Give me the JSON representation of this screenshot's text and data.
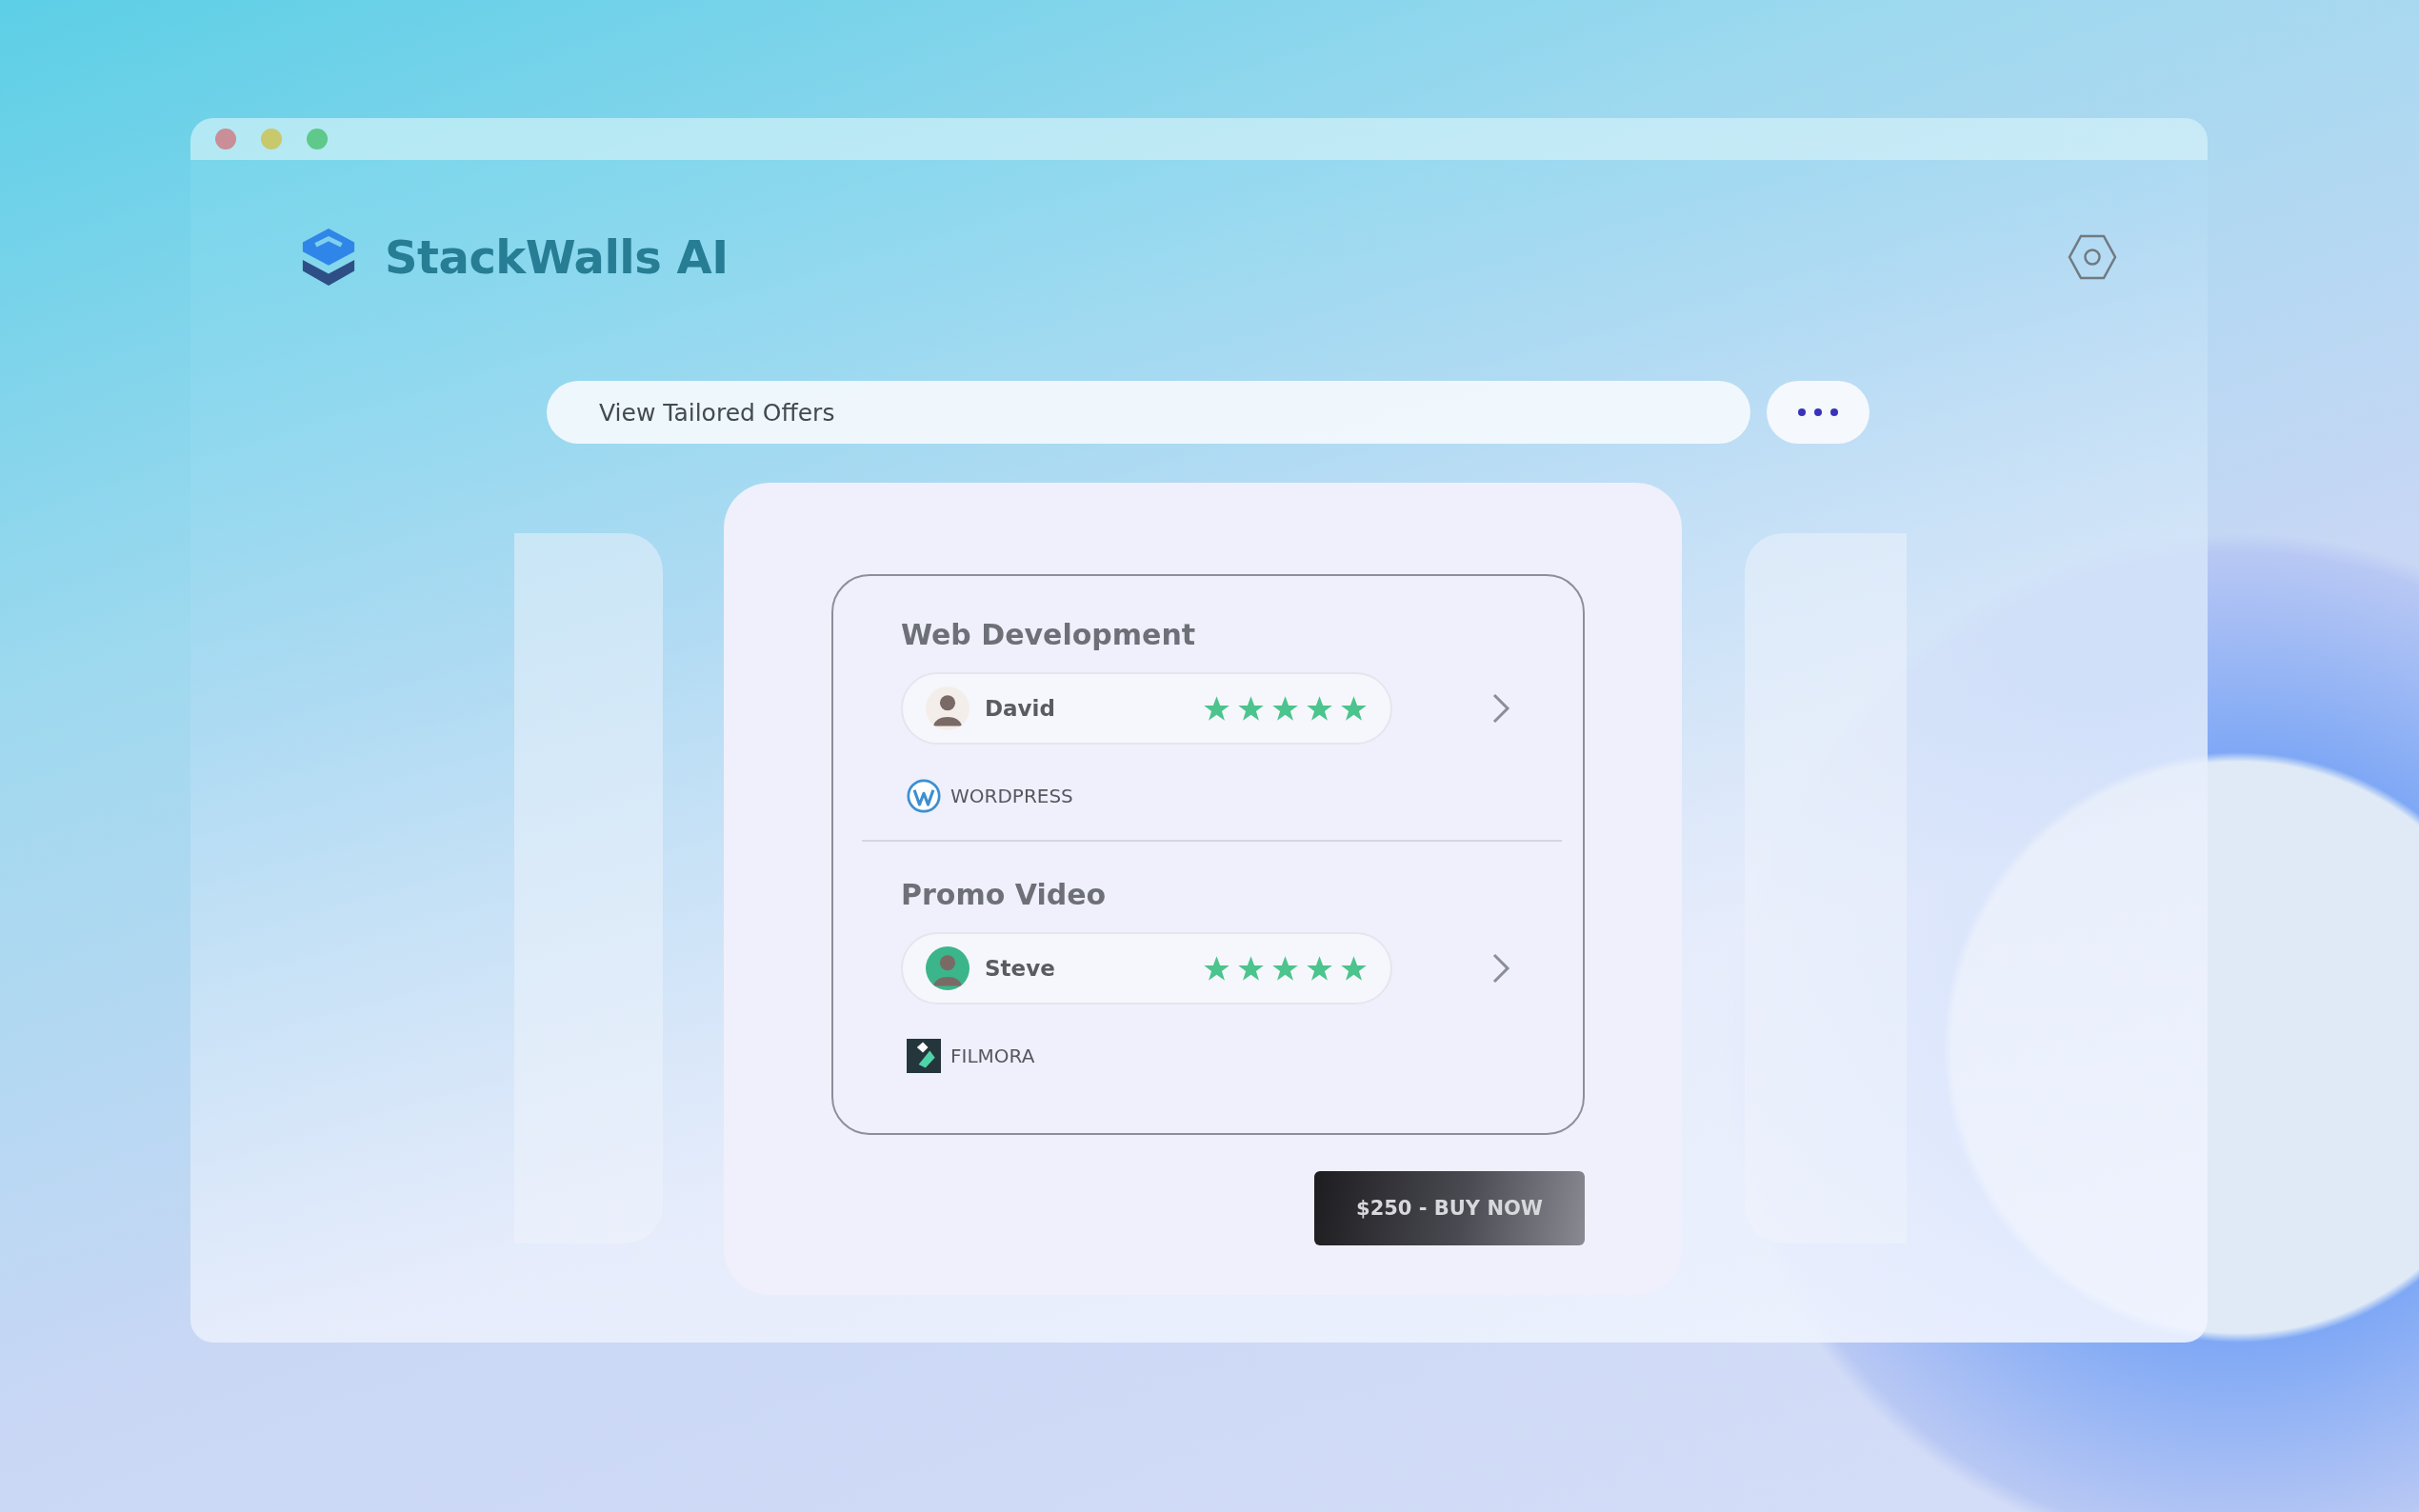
{
  "brand": {
    "name": "StackWalls AI"
  },
  "search": {
    "value": "View Tailored Offers"
  },
  "offers": [
    {
      "category": "Web Development",
      "provider": "David",
      "color": "#f4eeea",
      "stars": 5,
      "tool": "WORDPRESS",
      "kind": "wordpress"
    },
    {
      "category": "Promo Video",
      "provider": "Steve",
      "color": "#3bb58a",
      "stars": 5,
      "tool": "FILMORA",
      "kind": "filmora"
    }
  ],
  "buy_button": {
    "label": "$250 - BUY NOW"
  }
}
